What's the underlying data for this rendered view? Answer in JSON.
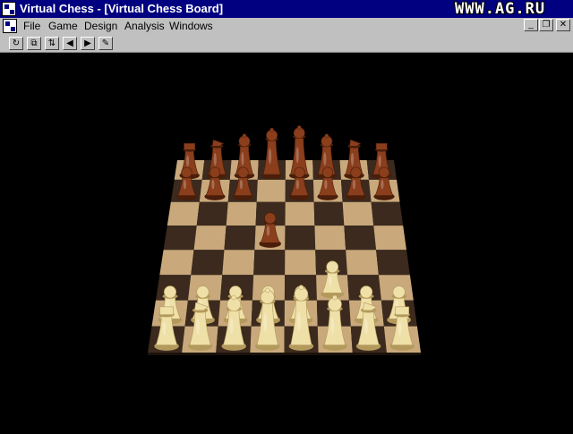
{
  "window": {
    "title": "Virtual Chess - [Virtual Chess Board]"
  },
  "watermark": "WWW.AG.RU",
  "menu": [
    "File",
    "Game",
    "Design",
    "Analysis",
    "Windows"
  ],
  "mdi_controls": [
    {
      "name": "minimize",
      "glyph": "_"
    },
    {
      "name": "restore",
      "glyph": "❐"
    },
    {
      "name": "close",
      "glyph": "✕"
    }
  ],
  "toolbar": [
    {
      "name": "rotate-board",
      "glyph": "↻"
    },
    {
      "name": "setup-position",
      "glyph": "⧉"
    },
    {
      "name": "flip-board",
      "glyph": "⇅"
    },
    {
      "name": "move-back",
      "glyph": "◀"
    },
    {
      "name": "move-forward",
      "glyph": "▶"
    },
    {
      "name": "edit-mode",
      "glyph": "✎"
    }
  ],
  "board": {
    "light_color": "#c9a97c",
    "dark_color": "#3c2a1e",
    "white_piece_color": "#efe0a8",
    "black_piece_color": "#8a3e1c",
    "pieces": [
      {
        "square": "a8",
        "color": "black",
        "type": "rook"
      },
      {
        "square": "b8",
        "color": "black",
        "type": "knight"
      },
      {
        "square": "c8",
        "color": "black",
        "type": "bishop"
      },
      {
        "square": "d8",
        "color": "black",
        "type": "queen"
      },
      {
        "square": "e8",
        "color": "black",
        "type": "king"
      },
      {
        "square": "f8",
        "color": "black",
        "type": "bishop"
      },
      {
        "square": "g8",
        "color": "black",
        "type": "knight"
      },
      {
        "square": "h8",
        "color": "black",
        "type": "rook"
      },
      {
        "square": "a7",
        "color": "black",
        "type": "pawn"
      },
      {
        "square": "b7",
        "color": "black",
        "type": "pawn"
      },
      {
        "square": "c7",
        "color": "black",
        "type": "pawn"
      },
      {
        "square": "e7",
        "color": "black",
        "type": "pawn"
      },
      {
        "square": "f7",
        "color": "black",
        "type": "pawn"
      },
      {
        "square": "g7",
        "color": "black",
        "type": "pawn"
      },
      {
        "square": "h7",
        "color": "black",
        "type": "pawn"
      },
      {
        "square": "d5",
        "color": "black",
        "type": "pawn"
      },
      {
        "square": "f3",
        "color": "white",
        "type": "pawn"
      },
      {
        "square": "a2",
        "color": "white",
        "type": "pawn"
      },
      {
        "square": "b2",
        "color": "white",
        "type": "pawn"
      },
      {
        "square": "c2",
        "color": "white",
        "type": "pawn"
      },
      {
        "square": "d2",
        "color": "white",
        "type": "pawn"
      },
      {
        "square": "e2",
        "color": "white",
        "type": "pawn"
      },
      {
        "square": "g2",
        "color": "white",
        "type": "pawn"
      },
      {
        "square": "h2",
        "color": "white",
        "type": "pawn"
      },
      {
        "square": "a1",
        "color": "white",
        "type": "rook"
      },
      {
        "square": "b1",
        "color": "white",
        "type": "knight"
      },
      {
        "square": "c1",
        "color": "white",
        "type": "bishop"
      },
      {
        "square": "d1",
        "color": "white",
        "type": "queen"
      },
      {
        "square": "e1",
        "color": "white",
        "type": "king"
      },
      {
        "square": "f1",
        "color": "white",
        "type": "bishop"
      },
      {
        "square": "g1",
        "color": "white",
        "type": "knight"
      },
      {
        "square": "h1",
        "color": "white",
        "type": "rook"
      }
    ]
  }
}
